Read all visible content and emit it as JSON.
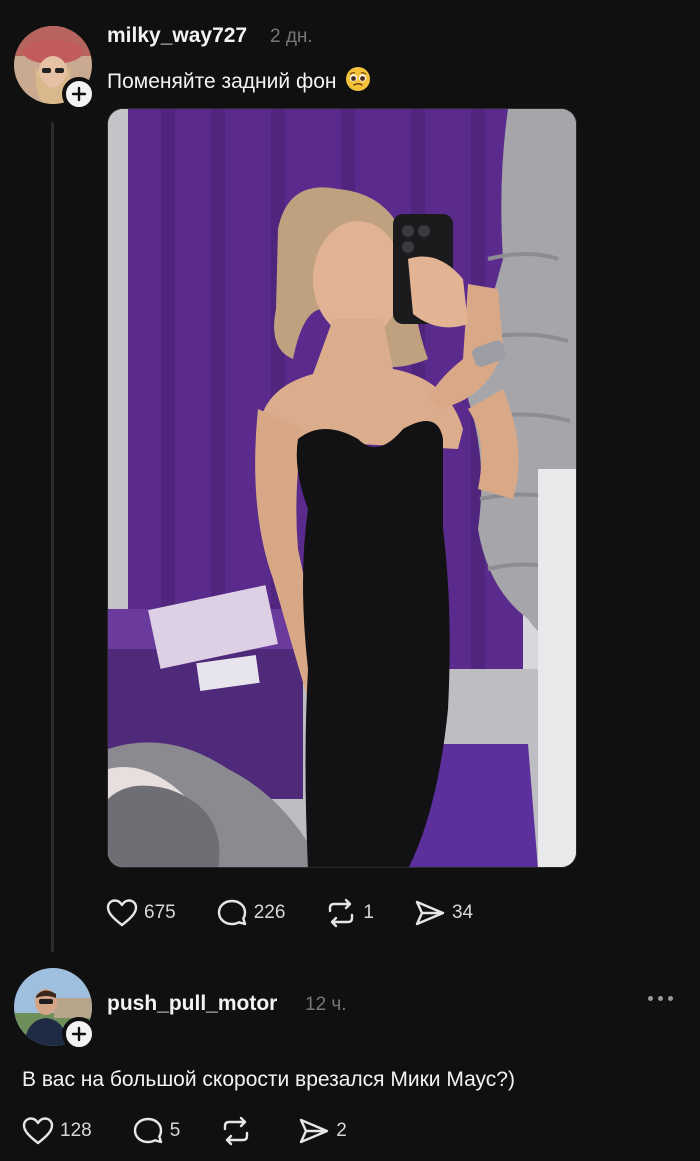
{
  "post": {
    "username": "milky_way727",
    "time": "2 дн.",
    "text": "Поменяйте задний фон",
    "emoji_icon": "pleading-face-icon",
    "stats": {
      "likes": "675",
      "comments": "226",
      "reposts": "1",
      "shares": "34"
    }
  },
  "reply": {
    "username": "push_pull_motor",
    "time": "12 ч.",
    "text": "В вас на большой скорости врезался Мики Маус?)",
    "stats": {
      "likes": "128",
      "comments": "5",
      "reposts": "",
      "shares": "2"
    }
  },
  "colors": {
    "background": "#101010",
    "text": "#f3f3f3",
    "muted": "#777777",
    "curtain": "#5a2b8c"
  }
}
